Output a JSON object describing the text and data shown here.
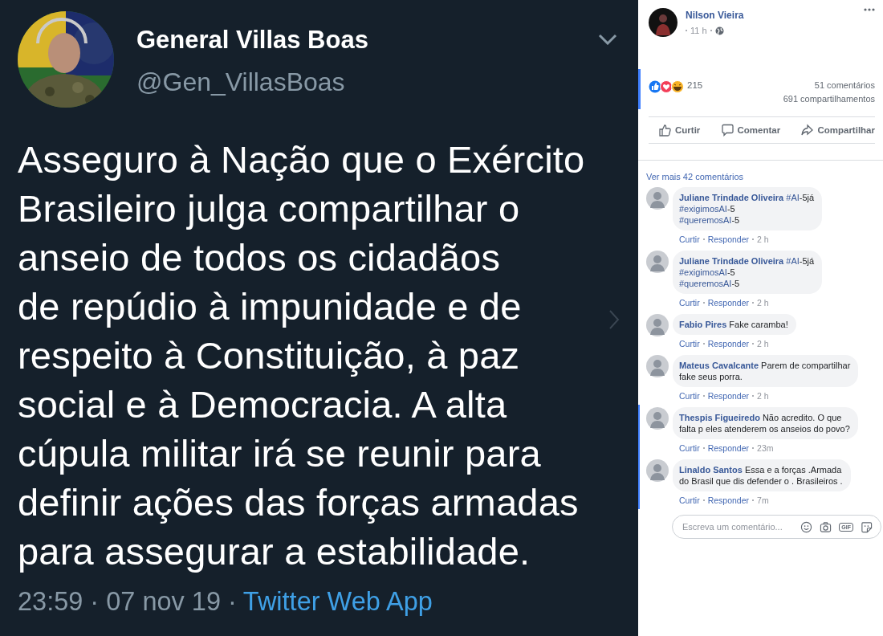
{
  "tweet": {
    "author": "General Villas Boas",
    "handle": "@Gen_VillasBoas",
    "lines": [
      "Asseguro à Nação que o Exército",
      "Brasileiro julga compartilhar o",
      "anseio de todos os cidadãos",
      "de repúdio à impunidade e de",
      "respeito à Constituição, à paz",
      "social e à Democracia. A alta",
      "cúpula militar irá se reunir para",
      "definir ações das forças armadas",
      "para assegurar a estabilidade."
    ],
    "timestamp": "23:59 · 07 nov 19 ·",
    "source": "Twitter Web App"
  },
  "post": {
    "author": "Nilson Vieira",
    "time": "11 h",
    "reaction_count": "215",
    "comments_count": "51 comentários",
    "shares_count": "691 compartilhamentos",
    "highlighted": true,
    "actions": [
      {
        "kind": "like",
        "label": "Curtir"
      },
      {
        "kind": "comment",
        "label": "Comentar"
      },
      {
        "kind": "share",
        "label": "Compartilhar"
      }
    ]
  },
  "comments_more": "Ver mais 42 comentários",
  "comments": [
    {
      "author": "Juliane Trindade Oliveira",
      "highlighted": false,
      "segments": [
        {
          "kind": "hashtag",
          "text": "#AI"
        },
        {
          "kind": "plain",
          "text": "-5já"
        },
        {
          "kind": "break"
        },
        {
          "kind": "hashtag",
          "text": "#exigimosAI"
        },
        {
          "kind": "plain",
          "text": "-5"
        },
        {
          "kind": "break"
        },
        {
          "kind": "hashtag",
          "text": "#queremosAI"
        },
        {
          "kind": "plain",
          "text": "-5"
        }
      ],
      "like": "Curtir",
      "reply": "Responder",
      "time": "2 h"
    },
    {
      "author": "Juliane Trindade Oliveira",
      "highlighted": false,
      "segments": [
        {
          "kind": "hashtag",
          "text": "#AI"
        },
        {
          "kind": "plain",
          "text": "-5já"
        },
        {
          "kind": "break"
        },
        {
          "kind": "hashtag",
          "text": "#exigimosAI"
        },
        {
          "kind": "plain",
          "text": "-5"
        },
        {
          "kind": "break"
        },
        {
          "kind": "hashtag",
          "text": "#queremosAI"
        },
        {
          "kind": "plain",
          "text": "-5"
        }
      ],
      "like": "Curtir",
      "reply": "Responder",
      "time": "2 h"
    },
    {
      "author": "Fabio Pires",
      "highlighted": false,
      "segments": [
        {
          "kind": "plain",
          "text": "Fake caramba!"
        }
      ],
      "like": "Curtir",
      "reply": "Responder",
      "time": "2 h"
    },
    {
      "author": "Mateus Cavalcante",
      "highlighted": false,
      "segments": [
        {
          "kind": "plain",
          "text": "Parem de compartilhar"
        },
        {
          "kind": "break"
        },
        {
          "kind": "plain",
          "text": "fake seus porra."
        }
      ],
      "like": "Curtir",
      "reply": "Responder",
      "time": "2 h"
    },
    {
      "author": "Thespis Figueiredo",
      "highlighted": true,
      "segments": [
        {
          "kind": "plain",
          "text": "Não acredito. O que"
        },
        {
          "kind": "break"
        },
        {
          "kind": "plain",
          "text": "falta p eles atenderem os anseios do povo?"
        }
      ],
      "like": "Curtir",
      "reply": "Responder",
      "time": "23m"
    },
    {
      "author": "Linaldo Santos",
      "highlighted": true,
      "segments": [
        {
          "kind": "plain",
          "text": "Essa e a forças .Armada"
        },
        {
          "kind": "break"
        },
        {
          "kind": "plain",
          "text": "do Brasil que dis defender o . Brasileiros ."
        }
      ],
      "like": "Curtir",
      "reply": "Responder",
      "time": "7m"
    }
  ],
  "composer": {
    "placeholder": "Escreva um comentário...",
    "gif_label": "GIF"
  }
}
